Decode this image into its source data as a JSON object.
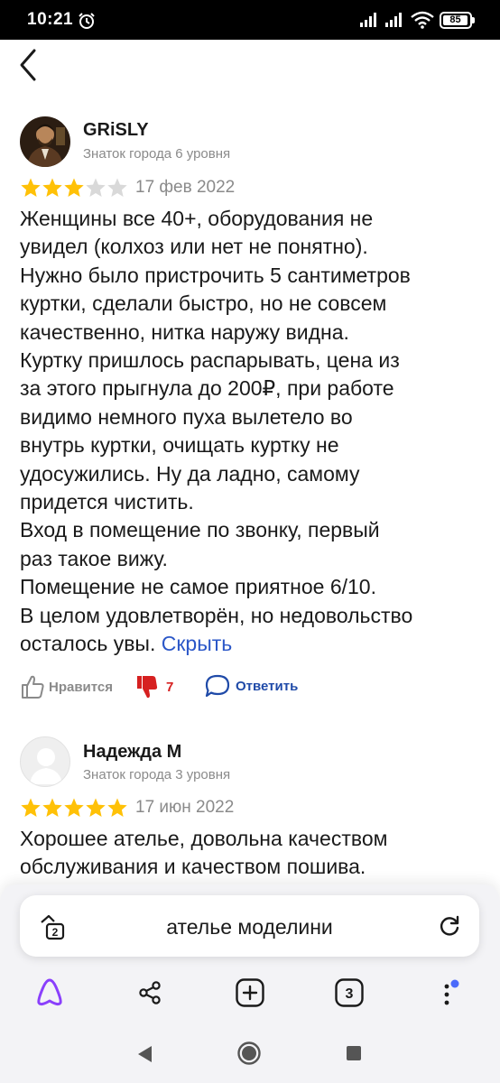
{
  "status_bar": {
    "time": "10:21",
    "battery": "85"
  },
  "reviews": [
    {
      "author": "GRiSLY",
      "level": "Знаток города 6 уровня",
      "rating": 3,
      "date": "17 фев 2022",
      "text": "Женщины все 40+, оборудования не\nувидел (колхоз или нет не понятно).\nНужно было пристрочить 5 сантиметров\nкуртки, сделали быстро, но не совсем\nкачественно, нитка наружу видна.\nКуртку пришлось распарывать, цена из\nза этого прыгнула до 200₽, при работе\nвидимо немного пуха вылетело во\nвнутрь куртки, очищать куртку не\nудосужились. Ну да ладно, самому\nпридется чистить.\nВход в помещение по звонку, первый\nраз такое вижу.\nПомещение не самое приятное 6/10.\nВ целом удовлетворён, но недовольство\nосталось увы. ",
      "hide_label": "Скрыть",
      "like_label": "Нравится",
      "dislike_count": "7",
      "reply_label": "Ответить"
    },
    {
      "author": "Надежда М",
      "level": "Знаток города 3 уровня",
      "rating": 5,
      "date": "17 июн 2022",
      "text": "Хорошее ателье, довольна качеством\nобслуживания и качеством пошива."
    }
  ],
  "browser": {
    "address": "ателье моделини",
    "tabs_mini_count": "2",
    "tabs_count": "3"
  },
  "colors": {
    "star_active": "#ffc107",
    "star_inactive": "#d9d9d9",
    "link": "#2b57c8",
    "dislike": "#d62020",
    "alice": "#8a3ffc",
    "notification_dot": "#4b6bfb"
  }
}
